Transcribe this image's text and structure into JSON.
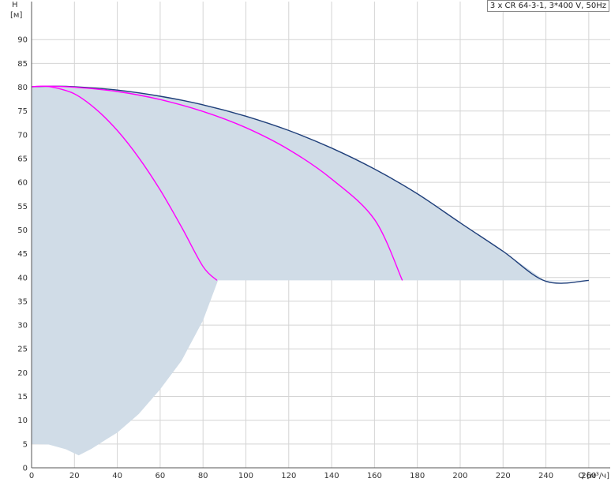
{
  "chart_data": {
    "type": "line",
    "title": "3 x CR 64-3-1, 3*400 V, 50Hz",
    "ylabel": "H",
    "yunit": "[м]",
    "xlabel": "Q [м³/ч]",
    "xlim": [
      0,
      270
    ],
    "ylim": [
      0,
      98
    ],
    "xticks": [
      0,
      20,
      40,
      60,
      80,
      100,
      120,
      140,
      160,
      180,
      200,
      220,
      240,
      260
    ],
    "yticks": [
      0,
      5,
      10,
      15,
      20,
      25,
      30,
      35,
      40,
      45,
      50,
      55,
      60,
      65,
      70,
      75,
      80,
      85,
      90
    ],
    "grid": true,
    "legend_position": "top-right",
    "operating_region": {
      "color": "#d0dce7",
      "boundary": [
        [
          0,
          80.1
        ],
        [
          20,
          80.1
        ],
        [
          40,
          79.4
        ],
        [
          60,
          78.1
        ],
        [
          80,
          76.3
        ],
        [
          100,
          73.9
        ],
        [
          120,
          70.9
        ],
        [
          140,
          67.2
        ],
        [
          160,
          62.8
        ],
        [
          180,
          57.6
        ],
        [
          200,
          51.5
        ],
        [
          220,
          45.5
        ],
        [
          240,
          39.2
        ],
        [
          260,
          39.4
        ],
        [
          273,
          39.4
        ],
        [
          273,
          39.4
        ],
        [
          87,
          39.4
        ],
        [
          80,
          31.0
        ],
        [
          70,
          22.5
        ],
        [
          60,
          16.5
        ],
        [
          50,
          11.3
        ],
        [
          40,
          7.4
        ],
        [
          35,
          6.0
        ],
        [
          28,
          4.0
        ],
        [
          22,
          2.6
        ],
        [
          16,
          3.9
        ],
        [
          8,
          4.9
        ],
        [
          0,
          5.0
        ]
      ]
    },
    "series": [
      {
        "color": "#1f3f7a",
        "values": [
          [
            0,
            80.1
          ],
          [
            10,
            80.2
          ],
          [
            20,
            80.1
          ],
          [
            40,
            79.4
          ],
          [
            60,
            78.1
          ],
          [
            80,
            76.3
          ],
          [
            100,
            73.9
          ],
          [
            120,
            70.9
          ],
          [
            140,
            67.2
          ],
          [
            160,
            62.8
          ],
          [
            180,
            57.6
          ],
          [
            200,
            51.5
          ],
          [
            220,
            45.5
          ],
          [
            240,
            39.2
          ],
          [
            260,
            39.4
          ]
        ]
      },
      {
        "color": "#ff00ff",
        "values": [
          [
            0,
            80.1
          ],
          [
            7,
            80.2
          ],
          [
            20,
            80.0
          ],
          [
            40,
            79.1
          ],
          [
            60,
            77.4
          ],
          [
            80,
            74.9
          ],
          [
            100,
            71.5
          ],
          [
            120,
            66.9
          ],
          [
            140,
            60.7
          ],
          [
            160,
            52.2
          ],
          [
            173,
            39.4
          ]
        ]
      },
      {
        "color": "#ff00ff",
        "values": [
          [
            0,
            80.1
          ],
          [
            5,
            80.2
          ],
          [
            10,
            80.0
          ],
          [
            20,
            78.6
          ],
          [
            30,
            75.4
          ],
          [
            40,
            70.9
          ],
          [
            50,
            65.2
          ],
          [
            60,
            58.4
          ],
          [
            70,
            50.6
          ],
          [
            80,
            42.3
          ],
          [
            86.5,
            39.4
          ]
        ]
      }
    ]
  }
}
